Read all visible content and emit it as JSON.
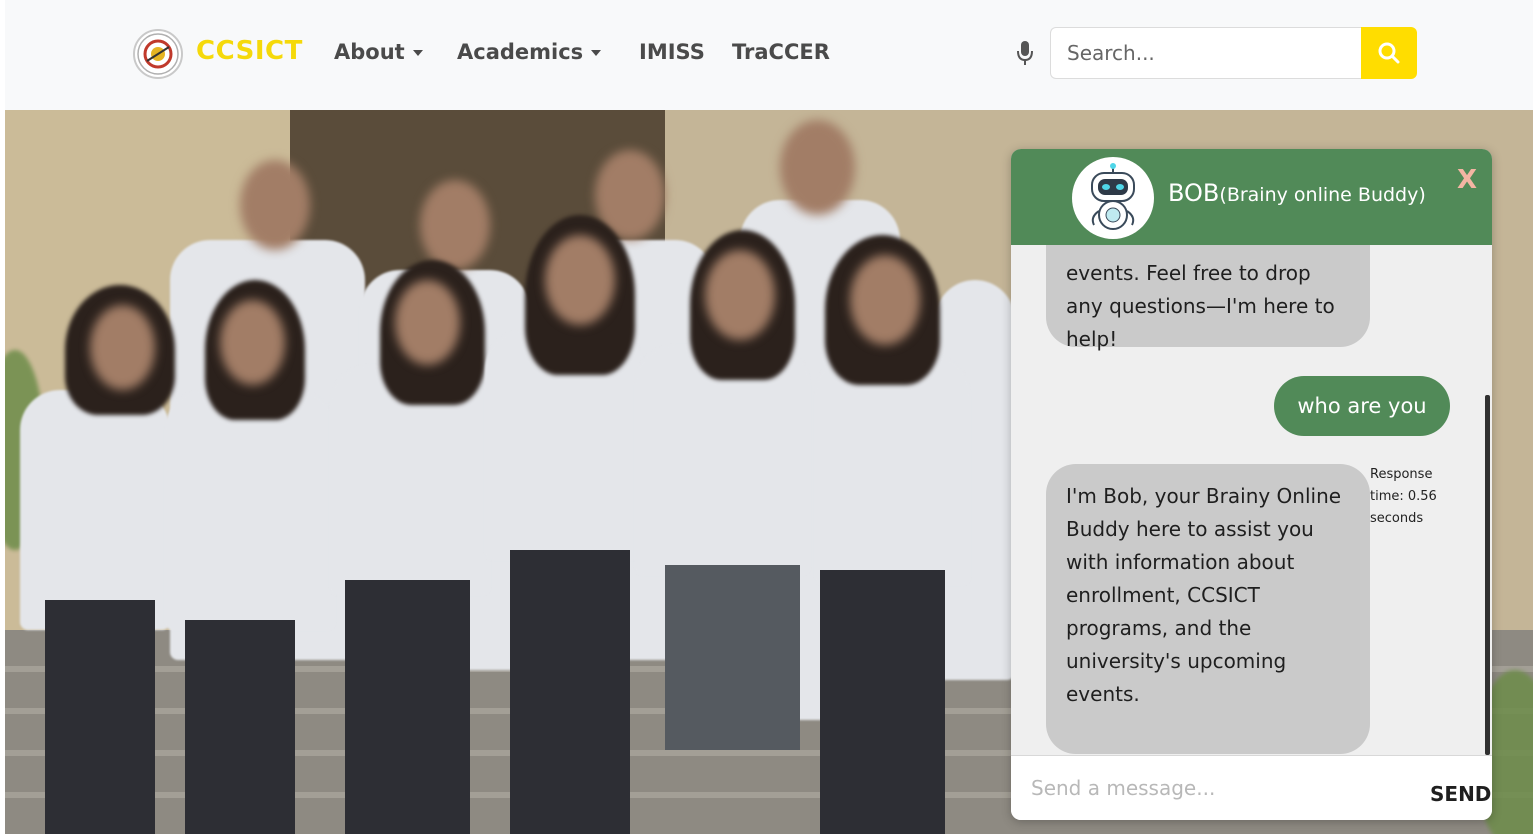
{
  "navbar": {
    "brand": "CCSICT",
    "logo_icon": "ccsict-seal-logo",
    "items": [
      {
        "label": "About",
        "has_dropdown": true
      },
      {
        "label": "Academics",
        "has_dropdown": true
      },
      {
        "label": "IMISS",
        "has_dropdown": false
      },
      {
        "label": "TraCCER",
        "has_dropdown": false
      }
    ],
    "search": {
      "placeholder": "Search...",
      "value": "",
      "mic_icon": "microphone-icon",
      "button_icon": "search-icon"
    }
  },
  "chat": {
    "title": "BOB",
    "subtitle": "(Brainy online Buddy)",
    "avatar_icon": "robot-icon",
    "close_label": "X",
    "messages": [
      {
        "from": "bot",
        "text": "events. Feel free to drop any questions—I'm here to help!"
      },
      {
        "from": "user",
        "text": "who are you"
      },
      {
        "from": "bot",
        "text": "I'm Bob, your Brainy Online Buddy here to assist you with information about enrollment, CCSICT programs, and the university's upcoming events."
      }
    ],
    "response_time": "Response time: 0.56 seconds",
    "input_placeholder": "Send a message...",
    "send_label": "SEND"
  },
  "colors": {
    "brand_yellow": "#f5d90a",
    "search_button": "#ffdd00",
    "chat_green": "#518a58",
    "bot_bubble": "#cacaca",
    "close_x": "#f4b5a3"
  }
}
